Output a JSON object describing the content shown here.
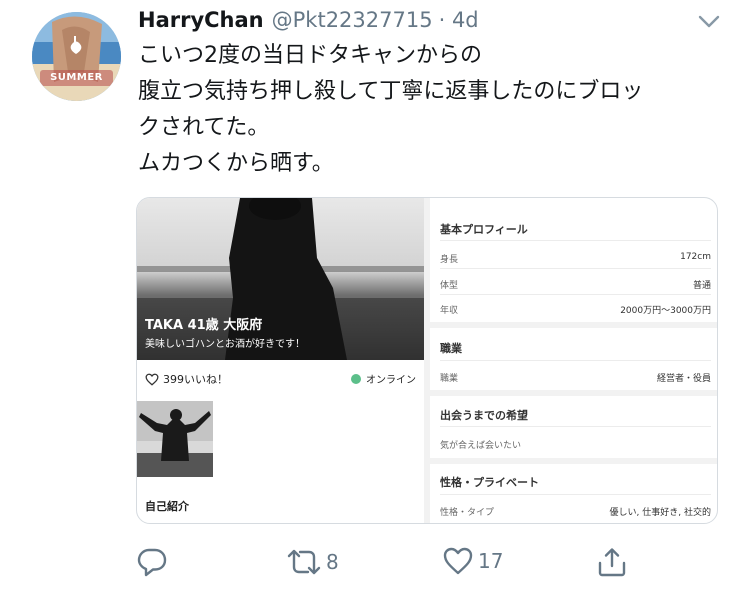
{
  "tweet": {
    "display_name": "HarryChan",
    "handle": "@Pkt22327715",
    "time": "· 4d",
    "avatar_text": "SUMMER",
    "text_lines": [
      "こいつ2度の当日ドタキャンからの",
      "腹立つ気持ち押し殺して丁寧に返事したのにブロッ",
      "クされてた。",
      "ムカつくから晒す。"
    ]
  },
  "card": {
    "profile_title": "TAKA  41歳  大阪府",
    "profile_message": "美味しいゴハンとお酒が好きです！",
    "likes": "399いいね！",
    "status": "オンライン",
    "status_color": "#5cbf8a",
    "intro_label": "自己紹介",
    "sections": {
      "basic": {
        "title": "基本プロフィール",
        "rows": [
          {
            "label": "身長",
            "value": "172cm"
          },
          {
            "label": "体型",
            "value": "普通"
          },
          {
            "label": "年収",
            "value": "2000万円〜3000万円"
          }
        ]
      },
      "job": {
        "title": "職業",
        "rows": [
          {
            "label": "職業",
            "value": "経営者・役員"
          }
        ]
      },
      "wish": {
        "title": "出会うまでの希望",
        "rows": [
          {
            "label": "気が合えば会いたい",
            "value": ""
          }
        ]
      },
      "personality": {
        "title": "性格・プライベート",
        "rows": [
          {
            "label": "性格・タイプ",
            "value": "優しい, 仕事好き, 社交的"
          }
        ]
      }
    }
  },
  "actions": {
    "reply_count": "",
    "retweet_count": "8",
    "like_count": "17",
    "icons": [
      "reply-icon",
      "retweet-icon",
      "like-icon",
      "share-icon"
    ]
  },
  "colors": {
    "text": "#14171a",
    "secondary": "#657786",
    "border": "#d6dbe0"
  }
}
